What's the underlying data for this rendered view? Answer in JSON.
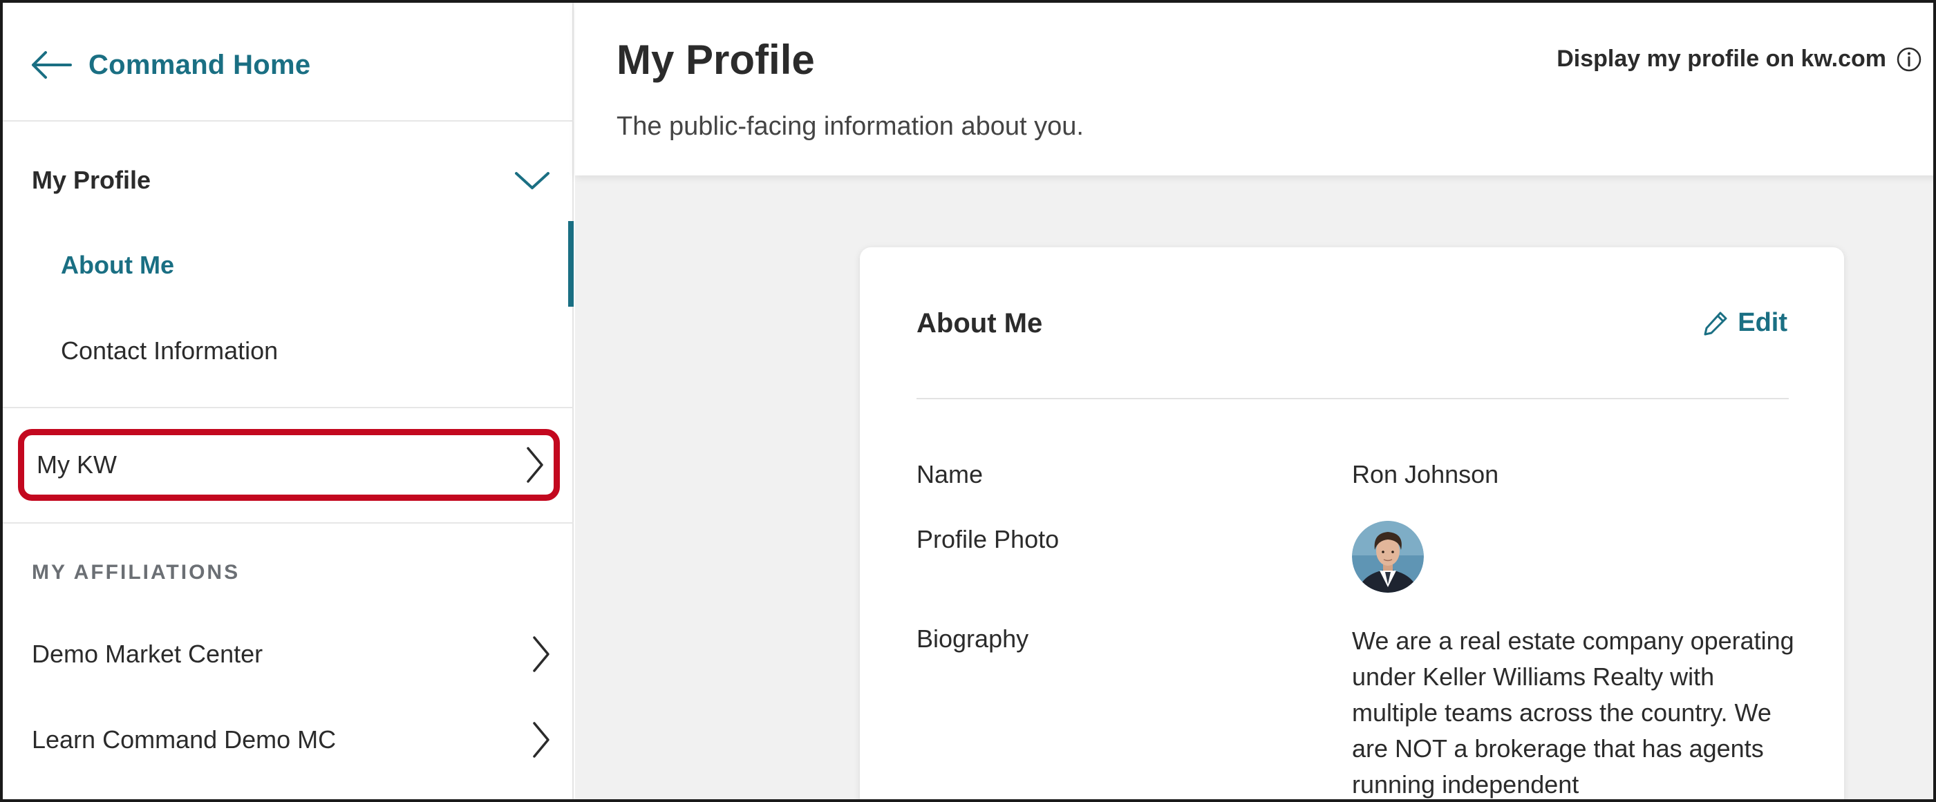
{
  "colors": {
    "accent": "#1a6f83",
    "highlight_outline": "#c3081f",
    "text": "#2b2b2b",
    "muted": "#6b6f74",
    "main_background": "#f1f1f1"
  },
  "sidebar": {
    "back_link": {
      "icon": "arrow-left-icon",
      "label": "Command Home"
    },
    "profile_section": {
      "label": "My Profile",
      "icon": "chevron-down-icon",
      "items": [
        {
          "label": "About Me",
          "active": true
        },
        {
          "label": "Contact Information",
          "active": false
        }
      ]
    },
    "my_kw": {
      "label": "My KW",
      "icon": "chevron-right-icon",
      "highlighted": true
    },
    "affiliations": {
      "title": "MY AFFILIATIONS",
      "items": [
        {
          "label": "Demo Market Center",
          "icon": "chevron-right-icon"
        },
        {
          "label": "Learn Command Demo MC",
          "icon": "chevron-right-icon"
        }
      ]
    }
  },
  "header": {
    "title": "My Profile",
    "subtitle": "The public-facing information about you.",
    "display_link": {
      "label": "Display my profile on kw.com",
      "icon": "info-icon"
    }
  },
  "card": {
    "title": "About Me",
    "edit": {
      "label": "Edit",
      "icon": "pencil-icon"
    },
    "fields": {
      "name": {
        "label": "Name",
        "value": "Ron Johnson"
      },
      "photo": {
        "label": "Profile Photo"
      },
      "biography": {
        "label": "Biography",
        "value": "We are a real estate company operating under Keller Williams Realty with multiple teams across the country. We are NOT a brokerage that has agents running independent"
      }
    }
  }
}
